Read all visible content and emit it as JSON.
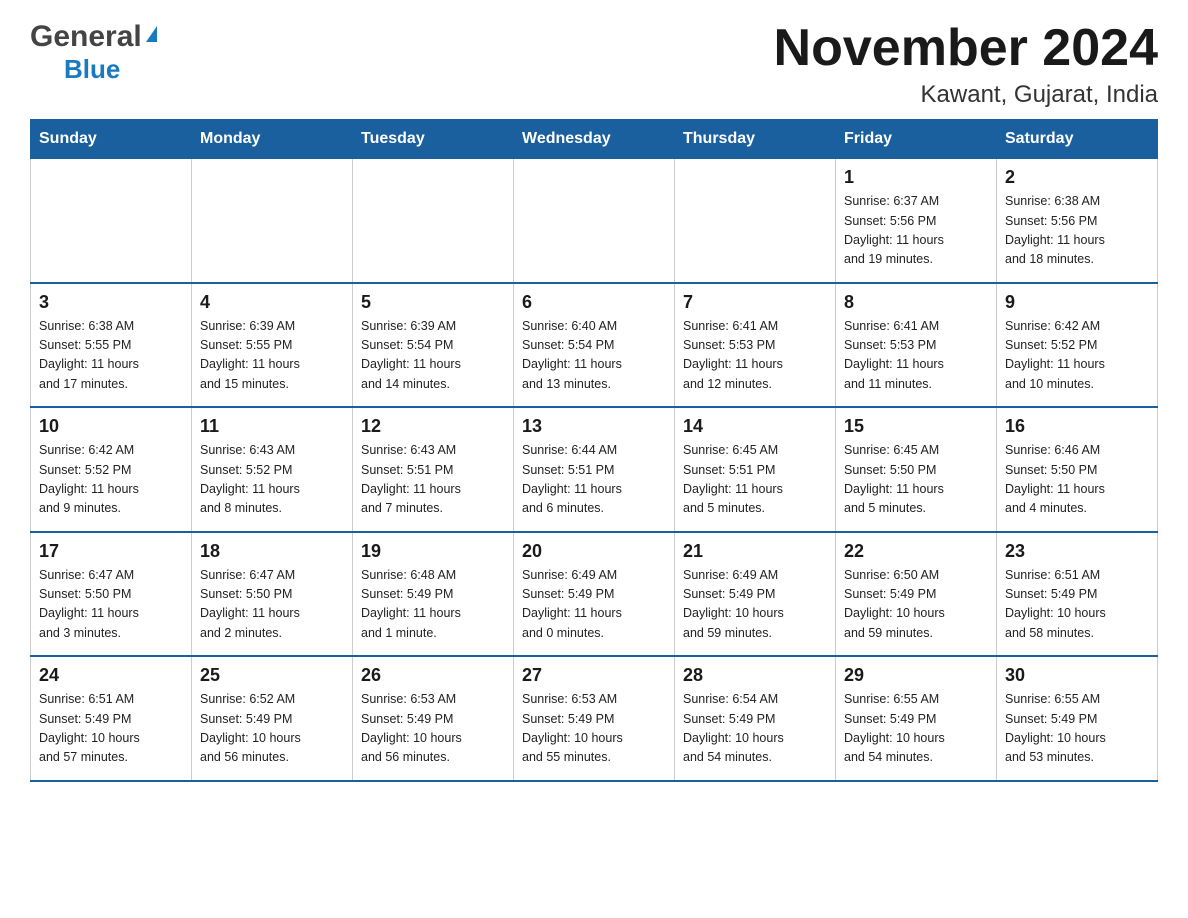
{
  "logo": {
    "general": "General",
    "blue": "Blue",
    "triangle": "▲"
  },
  "title": "November 2024",
  "subtitle": "Kawant, Gujarat, India",
  "weekdays": [
    "Sunday",
    "Monday",
    "Tuesday",
    "Wednesday",
    "Thursday",
    "Friday",
    "Saturday"
  ],
  "weeks": [
    [
      {
        "day": "",
        "info": ""
      },
      {
        "day": "",
        "info": ""
      },
      {
        "day": "",
        "info": ""
      },
      {
        "day": "",
        "info": ""
      },
      {
        "day": "",
        "info": ""
      },
      {
        "day": "1",
        "info": "Sunrise: 6:37 AM\nSunset: 5:56 PM\nDaylight: 11 hours\nand 19 minutes."
      },
      {
        "day": "2",
        "info": "Sunrise: 6:38 AM\nSunset: 5:56 PM\nDaylight: 11 hours\nand 18 minutes."
      }
    ],
    [
      {
        "day": "3",
        "info": "Sunrise: 6:38 AM\nSunset: 5:55 PM\nDaylight: 11 hours\nand 17 minutes."
      },
      {
        "day": "4",
        "info": "Sunrise: 6:39 AM\nSunset: 5:55 PM\nDaylight: 11 hours\nand 15 minutes."
      },
      {
        "day": "5",
        "info": "Sunrise: 6:39 AM\nSunset: 5:54 PM\nDaylight: 11 hours\nand 14 minutes."
      },
      {
        "day": "6",
        "info": "Sunrise: 6:40 AM\nSunset: 5:54 PM\nDaylight: 11 hours\nand 13 minutes."
      },
      {
        "day": "7",
        "info": "Sunrise: 6:41 AM\nSunset: 5:53 PM\nDaylight: 11 hours\nand 12 minutes."
      },
      {
        "day": "8",
        "info": "Sunrise: 6:41 AM\nSunset: 5:53 PM\nDaylight: 11 hours\nand 11 minutes."
      },
      {
        "day": "9",
        "info": "Sunrise: 6:42 AM\nSunset: 5:52 PM\nDaylight: 11 hours\nand 10 minutes."
      }
    ],
    [
      {
        "day": "10",
        "info": "Sunrise: 6:42 AM\nSunset: 5:52 PM\nDaylight: 11 hours\nand 9 minutes."
      },
      {
        "day": "11",
        "info": "Sunrise: 6:43 AM\nSunset: 5:52 PM\nDaylight: 11 hours\nand 8 minutes."
      },
      {
        "day": "12",
        "info": "Sunrise: 6:43 AM\nSunset: 5:51 PM\nDaylight: 11 hours\nand 7 minutes."
      },
      {
        "day": "13",
        "info": "Sunrise: 6:44 AM\nSunset: 5:51 PM\nDaylight: 11 hours\nand 6 minutes."
      },
      {
        "day": "14",
        "info": "Sunrise: 6:45 AM\nSunset: 5:51 PM\nDaylight: 11 hours\nand 5 minutes."
      },
      {
        "day": "15",
        "info": "Sunrise: 6:45 AM\nSunset: 5:50 PM\nDaylight: 11 hours\nand 5 minutes."
      },
      {
        "day": "16",
        "info": "Sunrise: 6:46 AM\nSunset: 5:50 PM\nDaylight: 11 hours\nand 4 minutes."
      }
    ],
    [
      {
        "day": "17",
        "info": "Sunrise: 6:47 AM\nSunset: 5:50 PM\nDaylight: 11 hours\nand 3 minutes."
      },
      {
        "day": "18",
        "info": "Sunrise: 6:47 AM\nSunset: 5:50 PM\nDaylight: 11 hours\nand 2 minutes."
      },
      {
        "day": "19",
        "info": "Sunrise: 6:48 AM\nSunset: 5:49 PM\nDaylight: 11 hours\nand 1 minute."
      },
      {
        "day": "20",
        "info": "Sunrise: 6:49 AM\nSunset: 5:49 PM\nDaylight: 11 hours\nand 0 minutes."
      },
      {
        "day": "21",
        "info": "Sunrise: 6:49 AM\nSunset: 5:49 PM\nDaylight: 10 hours\nand 59 minutes."
      },
      {
        "day": "22",
        "info": "Sunrise: 6:50 AM\nSunset: 5:49 PM\nDaylight: 10 hours\nand 59 minutes."
      },
      {
        "day": "23",
        "info": "Sunrise: 6:51 AM\nSunset: 5:49 PM\nDaylight: 10 hours\nand 58 minutes."
      }
    ],
    [
      {
        "day": "24",
        "info": "Sunrise: 6:51 AM\nSunset: 5:49 PM\nDaylight: 10 hours\nand 57 minutes."
      },
      {
        "day": "25",
        "info": "Sunrise: 6:52 AM\nSunset: 5:49 PM\nDaylight: 10 hours\nand 56 minutes."
      },
      {
        "day": "26",
        "info": "Sunrise: 6:53 AM\nSunset: 5:49 PM\nDaylight: 10 hours\nand 56 minutes."
      },
      {
        "day": "27",
        "info": "Sunrise: 6:53 AM\nSunset: 5:49 PM\nDaylight: 10 hours\nand 55 minutes."
      },
      {
        "day": "28",
        "info": "Sunrise: 6:54 AM\nSunset: 5:49 PM\nDaylight: 10 hours\nand 54 minutes."
      },
      {
        "day": "29",
        "info": "Sunrise: 6:55 AM\nSunset: 5:49 PM\nDaylight: 10 hours\nand 54 minutes."
      },
      {
        "day": "30",
        "info": "Sunrise: 6:55 AM\nSunset: 5:49 PM\nDaylight: 10 hours\nand 53 minutes."
      }
    ]
  ]
}
